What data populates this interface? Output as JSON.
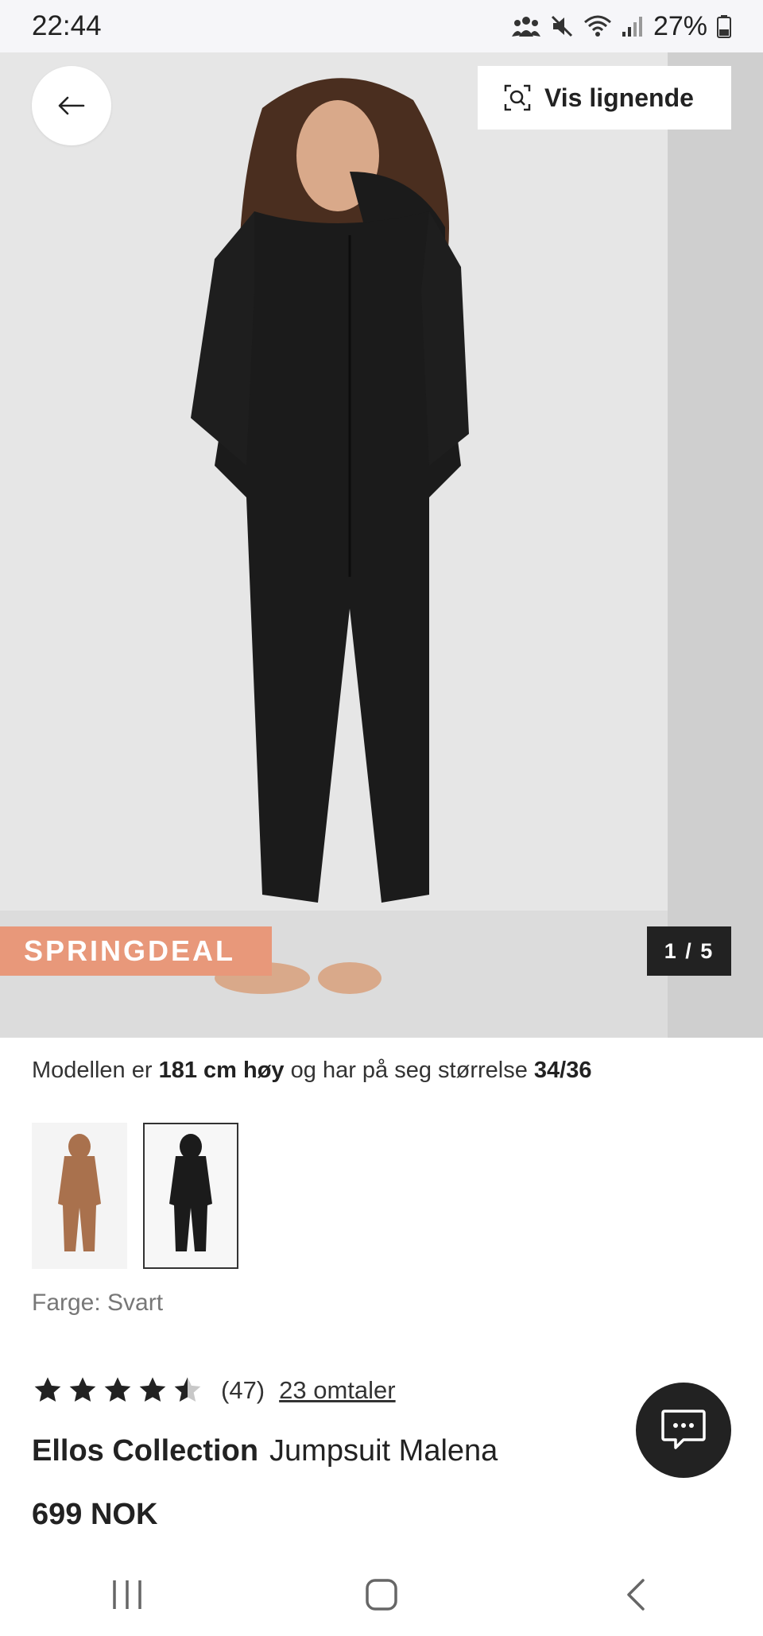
{
  "status_bar": {
    "time": "22:44",
    "battery": "27%",
    "icons": [
      "people-icon",
      "mute-icon",
      "wifi-icon",
      "signal-icon",
      "battery-icon"
    ]
  },
  "hero": {
    "similar_button_label": "Vis lignende",
    "deal_badge": "SPRINGDEAL",
    "page_counter": "1 / 5",
    "image_current": 1,
    "image_total": 5
  },
  "model_info": {
    "prefix": "Modellen er ",
    "height": "181 cm høy",
    "middle": " og har på seg størrelse ",
    "size": "34/36"
  },
  "color_variants": [
    {
      "name": "Brun",
      "swatch": "#a9714d",
      "selected": false
    },
    {
      "name": "Svart",
      "swatch": "#1b1b1b",
      "selected": true
    }
  ],
  "color_label": "Farge: Svart",
  "rating": {
    "stars": 4.5,
    "max": 5,
    "count_label": "(47)",
    "reviews_link": "23 omtaler"
  },
  "product": {
    "brand": "Ellos Collection",
    "name": "Jumpsuit Malena",
    "price": "699 NOK"
  },
  "colors": {
    "deal_badge": "#e8987a",
    "dark": "#222222",
    "garment": "#1b1b1b"
  }
}
